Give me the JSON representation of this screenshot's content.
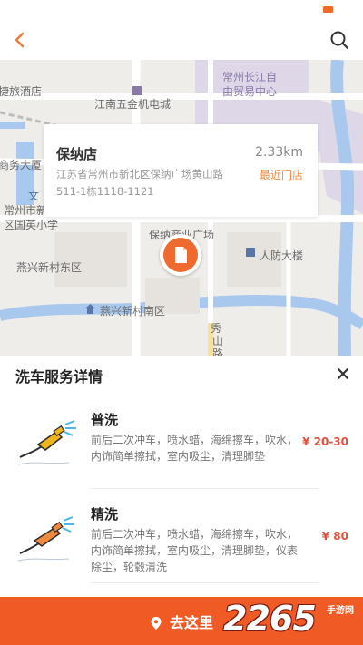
{
  "icons": {
    "back": "chevron-left-icon",
    "search": "search-icon",
    "close": "close-icon",
    "location": "location-pin-icon",
    "marker": "store-marker-icon"
  },
  "colors": {
    "accent": "#f05a24",
    "price": "#e0503c",
    "tag": "#f08a3e"
  },
  "map": {
    "labels": [
      "常州长江自",
      "由贸易中心",
      "江南五金机电城",
      "捷旅酒店",
      "商务大厦",
      "文",
      "常州市新",
      "区国英小学",
      "保纳商业广场",
      "人防大楼",
      "燕兴新村东区",
      "燕兴新村南区",
      "秀",
      "山",
      "路"
    ]
  },
  "store": {
    "name": "保纳店",
    "distance": "2.33km",
    "address": "江苏省常州市新北区保纳广场黄山路511-1栋1118-1121",
    "tag": "最近门店"
  },
  "panel": {
    "title": "洗车服务详情"
  },
  "services": [
    {
      "name": "普洗",
      "description": "前后二次冲车，喷水蜡，海绵擦车，吹水，内饰简单擦拭，室内吸尘，清理脚垫",
      "price": "¥ 20-30"
    },
    {
      "name": "精洗",
      "description": "前后二次冲车，喷水蜡，海绵擦车，吹水，内饰简单擦拭，室内吸尘，清理脚垫，仪表除尘，轮毂清洗",
      "price": "¥ 80"
    }
  ],
  "action": {
    "go_label": "去这里"
  },
  "watermark": {
    "number": "2265",
    "unit": ".com",
    "site": "手游网"
  }
}
